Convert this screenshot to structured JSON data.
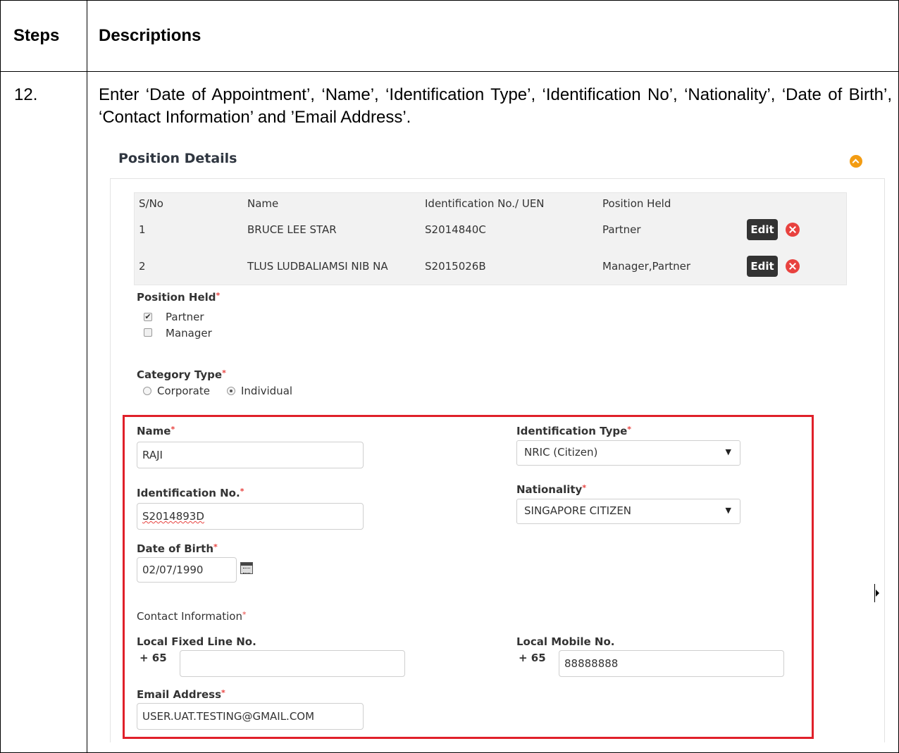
{
  "table": {
    "col_steps": "Steps",
    "col_descriptions": "Descriptions",
    "step_number": "12.",
    "step_description": "Enter ‘Date of Appointment’, ‘Name’, ‘Identification Type’, ‘Identification No’, ‘Nationality’, ‘Date of Birth’, ‘Contact Information’ and ’Email Address’."
  },
  "section": {
    "title": "Position Details",
    "collapse_icon": "chevron-up-icon"
  },
  "positions": {
    "headers": [
      "S/No",
      "Name",
      "Identification No./ UEN",
      "Position Held"
    ],
    "rows": [
      {
        "sno": "1",
        "name": "BRUCE LEE STAR",
        "id": "S2014840C",
        "position": "Partner",
        "edit": "Edit"
      },
      {
        "sno": "2",
        "name": "TLUS LUDBALIAMSI NIB NA",
        "id": "S2015026B",
        "position": "Manager,Partner",
        "edit": "Edit"
      }
    ]
  },
  "position_held": {
    "label": "Position Held",
    "options": [
      {
        "label": "Partner",
        "checked": true
      },
      {
        "label": "Manager",
        "checked": false
      }
    ]
  },
  "category_type": {
    "label": "Category Type",
    "options": [
      {
        "label": "Corporate",
        "selected": false
      },
      {
        "label": "Individual",
        "selected": true
      }
    ]
  },
  "form": {
    "name_label": "Name",
    "name_value": "RAJI",
    "id_type_label": "Identification Type",
    "id_type_value": "NRIC (Citizen)",
    "id_no_label": "Identification No.",
    "id_no_value": "S2014893D",
    "nationality_label": "Nationality",
    "nationality_value": "SINGAPORE CITIZEN",
    "dob_label": "Date of Birth",
    "dob_value": "02/07/1990",
    "contact_label": "Contact Information",
    "fixed_line_label": "Local Fixed Line No.",
    "fixed_line_prefix": "+ 65",
    "fixed_line_value": "",
    "mobile_label": "Local Mobile No.",
    "mobile_prefix": "+ 65",
    "mobile_value": "88888888",
    "email_label": "Email Address",
    "email_value": "USER.UAT.TESTING@GMAIL.COM",
    "required_mark": "*",
    "select_arrow": "▼"
  },
  "colors": {
    "highlight_border": "#e0202a",
    "required": "#e8423f",
    "collapse": "#f39c12",
    "edit_button": "#333333"
  }
}
